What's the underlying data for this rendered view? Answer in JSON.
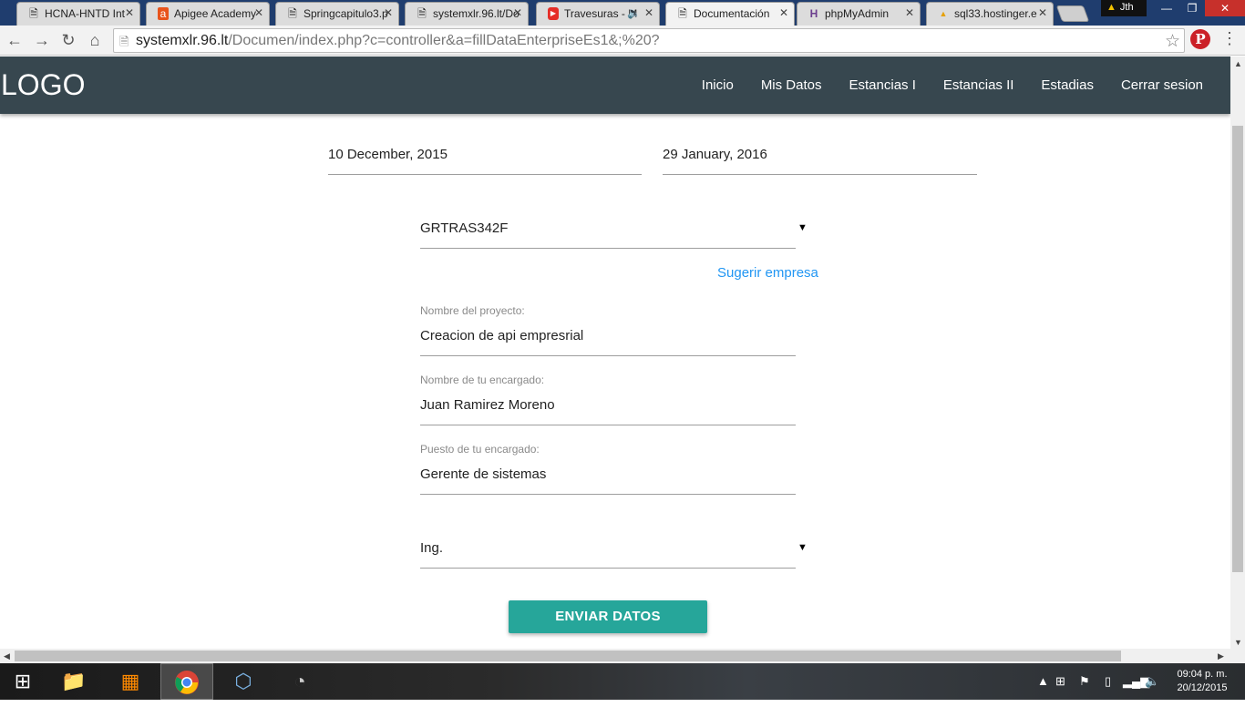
{
  "browser": {
    "tabs": [
      {
        "title": "HCNA-HNTD Int",
        "icon": "page-icon"
      },
      {
        "title": "Apigee Academy",
        "icon": "apigee-icon"
      },
      {
        "title": "Springcapitulo3.p",
        "icon": "page-icon"
      },
      {
        "title": "systemxlr.96.lt/Do",
        "icon": "page-icon"
      },
      {
        "title": "Travesuras - M",
        "icon": "youtube-icon"
      },
      {
        "title": "Documentación",
        "icon": "page-icon"
      },
      {
        "title": "phpMyAdmin",
        "icon": "phpmyadmin-icon"
      },
      {
        "title": "sql33.hostinger.e",
        "icon": "pma-icon"
      }
    ],
    "profile_name": "Jth",
    "url_host": "systemxlr.96.lt",
    "url_path": "/Documen/index.php?c=controller&a=fillDataEnterpriseEs1&;%20?"
  },
  "nav": {
    "logo": "LOGO",
    "links": [
      "Inicio",
      "Mis Datos",
      "Estancias I",
      "Estancias II",
      "Estadias",
      "Cerrar sesion"
    ]
  },
  "form": {
    "start_date": "10 December, 2015",
    "end_date": "29 January, 2016",
    "enterprise_select": "GRTRAS342F",
    "suggest_link": "Sugerir empresa",
    "project_name_label": "Nombre del proyecto:",
    "project_name_value": "Creacion de api empresrial",
    "manager_name_label": "Nombre de tu encargado:",
    "manager_name_value": "Juan Ramirez Moreno",
    "manager_position_label": "Puesto de tu encargado:",
    "manager_position_value": "Gerente de sistemas",
    "title_select": "Ing.",
    "submit_label": "ENVIAR DATOS"
  },
  "taskbar": {
    "time": "09:04 p. m.",
    "date": "20/12/2015"
  }
}
